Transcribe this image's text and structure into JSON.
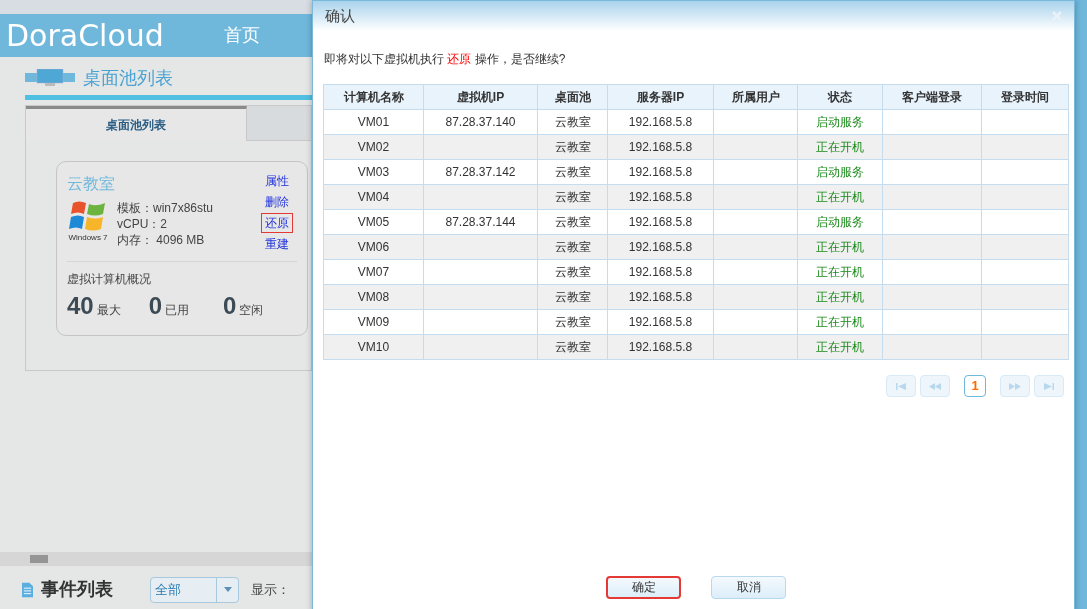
{
  "app": {
    "logo": "DoraCloud",
    "nav": [
      {
        "label": "首页"
      }
    ]
  },
  "section": {
    "title": "桌面池列表",
    "tabs": [
      {
        "label": "桌面池列表",
        "selected": true
      },
      {
        "selected": false
      }
    ]
  },
  "pool_card": {
    "name": "云教室",
    "os_label": "Windows 7",
    "specs": [
      "模板：win7x86stu",
      "vCPU：2",
      "内存： 4096 MB"
    ],
    "actions": [
      {
        "label": "属性",
        "highlighted": false
      },
      {
        "label": "删除",
        "highlighted": false
      },
      {
        "label": "还原",
        "highlighted": true
      },
      {
        "label": "重建",
        "highlighted": false
      }
    ],
    "summary_title": "虚拟计算机概况",
    "stats": [
      {
        "value": "40",
        "label": "最大"
      },
      {
        "value": "0",
        "label": "已用"
      },
      {
        "value": "0",
        "label": "空闲"
      }
    ]
  },
  "events": {
    "title": "事件列表",
    "filter": "全部",
    "display_label": "显示："
  },
  "dialog": {
    "title": "确认",
    "message": "即将对以下虚拟机执行 **还原** 操作，是否继续?",
    "columns": [
      "计算机名称",
      "虚拟机IP",
      "桌面池",
      "服务器IP",
      "所属用户",
      "状态",
      "客户端登录",
      "登录时间"
    ],
    "rows": [
      [
        "VM01",
        "87.28.37.140",
        "云教室",
        "192.168.5.8",
        "",
        "启动服务",
        "",
        ""
      ],
      [
        "VM02",
        "",
        "云教室",
        "192.168.5.8",
        "",
        "正在开机",
        "",
        ""
      ],
      [
        "VM03",
        "87.28.37.142",
        "云教室",
        "192.168.5.8",
        "",
        "启动服务",
        "",
        ""
      ],
      [
        "VM04",
        "",
        "云教室",
        "192.168.5.8",
        "",
        "正在开机",
        "",
        ""
      ],
      [
        "VM05",
        "87.28.37.144",
        "云教室",
        "192.168.5.8",
        "",
        "启动服务",
        "",
        ""
      ],
      [
        "VM06",
        "",
        "云教室",
        "192.168.5.8",
        "",
        "正在开机",
        "",
        ""
      ],
      [
        "VM07",
        "",
        "云教室",
        "192.168.5.8",
        "",
        "正在开机",
        "",
        ""
      ],
      [
        "VM08",
        "",
        "云教室",
        "192.168.5.8",
        "",
        "正在开机",
        "",
        ""
      ],
      [
        "VM09",
        "",
        "云教室",
        "192.168.5.8",
        "",
        "正在开机",
        "",
        ""
      ],
      [
        "VM10",
        "",
        "云教室",
        "192.168.5.8",
        "",
        "正在开机",
        "",
        ""
      ]
    ],
    "pages": [
      {
        "label": "1",
        "selected": true
      }
    ],
    "buttons": [
      {
        "label": "确定",
        "highlighted": true
      },
      {
        "label": "取消",
        "highlighted": false
      }
    ]
  }
}
